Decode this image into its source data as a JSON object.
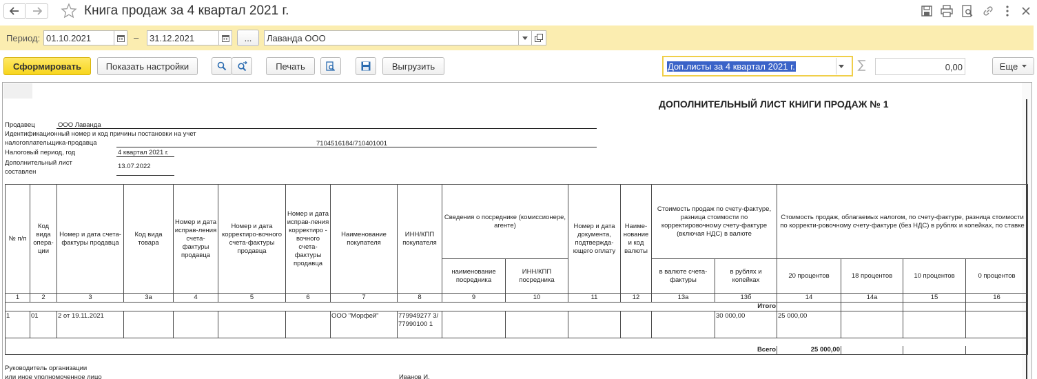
{
  "window": {
    "title": "Книга продаж за 4 квартал 2021 г."
  },
  "period": {
    "label": "Период:",
    "from": "01.10.2021",
    "separator": "–",
    "to": "31.12.2021",
    "choose_btn": "...",
    "organization": "Лаванда ООО"
  },
  "toolbar": {
    "generate": "Сформировать",
    "show_settings": "Показать настройки",
    "print": "Печать",
    "export": "Выгрузить",
    "more": "Еще",
    "section_select": "Доп.листы за 4 квартал 2021 г.",
    "sum_value": "0,00"
  },
  "report": {
    "doc_title": "ДОПОЛНИТЕЛЬНЫЙ ЛИСТ КНИГИ ПРОДАЖ № 1",
    "seller_label": "Продавец",
    "seller_value": "ООО Лаванда",
    "inn_label_1": "Идентификационный номер и код причины постановки на учет",
    "inn_label_2": "налогоплательщика-продавца",
    "inn_value": "7104516184/710401001",
    "period_label": "Налоговый период, год",
    "period_value": "4 квартал 2021 г.",
    "addsheet_label_1": "Дополнительный лист",
    "addsheet_label_2": "составлен",
    "addsheet_value": "13.07.2022",
    "headers": {
      "c1": "№ п/п",
      "c2": "Код вида опера-ции",
      "c3": "Номер и дата счета-фактуры продавца",
      "c3a": "Код вида товара",
      "c4": "Номер и дата исправ-ления счета-фактуры продавца",
      "c5": "Номер и дата корректиро-вочного счета-фактуры продавца",
      "c6": "Номер и дата исправ-ления корректиро - вочного счета-фактуры продавца",
      "c7": "Наименование покупателя",
      "c8": "ИНН/КПП покупателя",
      "c9_10": "Сведения о посреднике (комиссионере, агенте)",
      "c9": "наименование посредника",
      "c10": "ИНН/КПП посредника",
      "c11": "Номер и дата документа, подтвержда-ющего оплату",
      "c12": "Наиме-нование и код валюты",
      "c13": "Стоимость продаж по счету-фактуре, разница стоимости по корректировочному счету-фактуре (включая НДС) в валюте",
      "c13a": "в валюте счета-фактуры",
      "c13b": "в рублях и копейках",
      "c14_16": "Стоимость продаж, облагаемых налогом, по счету-фактуре, разница стоимости по корректи-ровочному счету-фактуре (без НДС) в рублях и копейках, по ставке",
      "c14": "20 процентов",
      "c14a": "18 процентов",
      "c15": "10 процентов",
      "c16": "0 процентов"
    },
    "col_numbers": [
      "1",
      "2",
      "3",
      "3а",
      "4",
      "5",
      "6",
      "7",
      "8",
      "9",
      "10",
      "11",
      "12",
      "13а",
      "13б",
      "14",
      "14а",
      "15",
      "16"
    ],
    "itogo_label": "Итого",
    "row": {
      "n": "1",
      "code": "01",
      "invoice": "2 от 19.11.2021",
      "buyer": "ООО \"Морфей\"",
      "buyer_inn": "779949277 3/77990100 1",
      "rub_total": "30 000,00",
      "vat20_base": "25 000,00"
    },
    "vsego_label": "Всего",
    "vsego_value": "25 000,00",
    "footer_label_1": "Руководитель организации",
    "footer_label_2": "или иное уполномоченное лицо",
    "footer_name": "Иванов И."
  }
}
